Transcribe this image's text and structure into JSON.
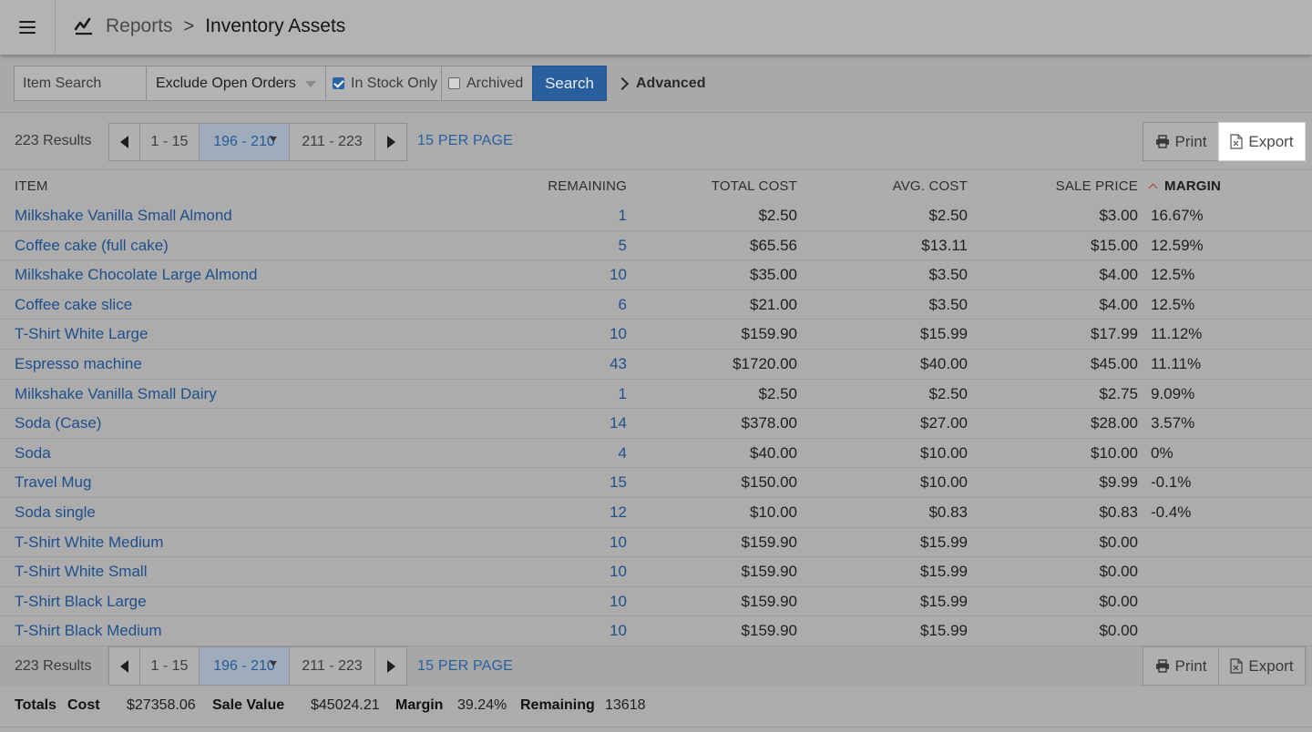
{
  "header": {
    "breadcrumb_parent": "Reports",
    "breadcrumb_separator": ">",
    "title": "Inventory Assets"
  },
  "filters": {
    "item_search_placeholder": "Item Search",
    "open_orders_select": "Exclude Open Orders",
    "in_stock_label": "In Stock Only",
    "in_stock_checked": true,
    "archived_label": "Archived",
    "archived_checked": false,
    "search_label": "Search",
    "advanced_label": "Advanced"
  },
  "pagination": {
    "results": "223 Results",
    "pages": [
      "1 - 15",
      "196 - 210",
      "211 - 223"
    ],
    "current_page": "196 - 210",
    "per_page": "15 PER PAGE",
    "print_label": "Print",
    "export_label": "Export"
  },
  "table": {
    "columns": [
      "ITEM",
      "REMAINING",
      "TOTAL COST",
      "AVG. COST",
      "SALE PRICE",
      "MARGIN"
    ],
    "sorted_column": "MARGIN",
    "rows": [
      {
        "item": "Milkshake Vanilla Small Almond",
        "remaining": "1",
        "total_cost": "$2.50",
        "avg_cost": "$2.50",
        "sale_price": "$3.00",
        "margin": "16.67%"
      },
      {
        "item": "Coffee cake (full cake)",
        "remaining": "5",
        "total_cost": "$65.56",
        "avg_cost": "$13.11",
        "sale_price": "$15.00",
        "margin": "12.59%"
      },
      {
        "item": "Milkshake Chocolate Large Almond",
        "remaining": "10",
        "total_cost": "$35.00",
        "avg_cost": "$3.50",
        "sale_price": "$4.00",
        "margin": "12.5%"
      },
      {
        "item": "Coffee cake slice",
        "remaining": "6",
        "total_cost": "$21.00",
        "avg_cost": "$3.50",
        "sale_price": "$4.00",
        "margin": "12.5%"
      },
      {
        "item": "T-Shirt White Large",
        "remaining": "10",
        "total_cost": "$159.90",
        "avg_cost": "$15.99",
        "sale_price": "$17.99",
        "margin": "11.12%"
      },
      {
        "item": "Espresso machine",
        "remaining": "43",
        "total_cost": "$1720.00",
        "avg_cost": "$40.00",
        "sale_price": "$45.00",
        "margin": "11.11%"
      },
      {
        "item": "Milkshake Vanilla Small Dairy",
        "remaining": "1",
        "total_cost": "$2.50",
        "avg_cost": "$2.50",
        "sale_price": "$2.75",
        "margin": "9.09%"
      },
      {
        "item": "Soda (Case)",
        "remaining": "14",
        "total_cost": "$378.00",
        "avg_cost": "$27.00",
        "sale_price": "$28.00",
        "margin": "3.57%"
      },
      {
        "item": "Soda",
        "remaining": "4",
        "total_cost": "$40.00",
        "avg_cost": "$10.00",
        "sale_price": "$10.00",
        "margin": "0%"
      },
      {
        "item": "Travel Mug",
        "remaining": "15",
        "total_cost": "$150.00",
        "avg_cost": "$10.00",
        "sale_price": "$9.99",
        "margin": "-0.1%"
      },
      {
        "item": "Soda single",
        "remaining": "12",
        "total_cost": "$10.00",
        "avg_cost": "$0.83",
        "sale_price": "$0.83",
        "margin": "-0.4%"
      },
      {
        "item": "T-Shirt White Medium",
        "remaining": "10",
        "total_cost": "$159.90",
        "avg_cost": "$15.99",
        "sale_price": "$0.00",
        "margin": ""
      },
      {
        "item": "T-Shirt White Small",
        "remaining": "10",
        "total_cost": "$159.90",
        "avg_cost": "$15.99",
        "sale_price": "$0.00",
        "margin": ""
      },
      {
        "item": "T-Shirt Black Large",
        "remaining": "10",
        "total_cost": "$159.90",
        "avg_cost": "$15.99",
        "sale_price": "$0.00",
        "margin": ""
      },
      {
        "item": "T-Shirt Black Medium",
        "remaining": "10",
        "total_cost": "$159.90",
        "avg_cost": "$15.99",
        "sale_price": "$0.00",
        "margin": ""
      }
    ]
  },
  "totals": {
    "label": "Totals",
    "cost_label": "Cost",
    "cost": "$27358.06",
    "sale_value_label": "Sale Value",
    "sale_value": "$45024.21",
    "margin_label": "Margin",
    "margin": "39.24%",
    "remaining_label": "Remaining",
    "remaining": "13618"
  },
  "icons": [
    "hamburger-menu-icon",
    "report-chart-icon",
    "checkbox-checked-icon",
    "checkbox-unchecked-icon",
    "chevron-right-icon",
    "arrow-left-icon",
    "arrow-right-icon",
    "printer-icon",
    "excel-file-icon",
    "sort-ascending-icon",
    "dropdown-caret-icon"
  ],
  "colors": {
    "link": "#1f4f8c",
    "primary_button": "#2a5f9e",
    "active_page": "#9facbc",
    "sort_indicator": "#b0382c"
  }
}
